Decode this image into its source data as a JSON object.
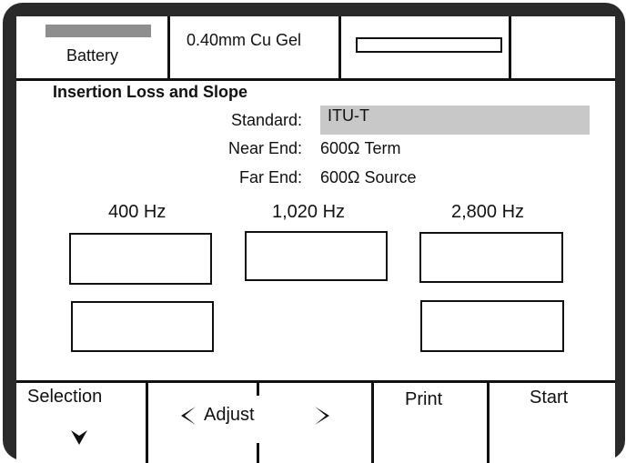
{
  "header": {
    "battery_label": "Battery",
    "cable_label": "0.40mm Cu Gel",
    "progress_fraction": 0
  },
  "main": {
    "title": "Insertion Loss and Slope",
    "standard_label": "Standard:",
    "standard_value": "ITU-T",
    "near_end_label": "Near End:",
    "near_end_value": "600Ω Term",
    "far_end_label": "Far End:",
    "far_end_value": "600Ω Source",
    "frequencies": [
      "400 Hz",
      "1,020 Hz",
      "2,800 Hz"
    ]
  },
  "softkeys": {
    "selection": "Selection",
    "adjust": "Adjust",
    "print": "Print",
    "start": "Start"
  },
  "icons": {
    "selection": "chevron-down-icon",
    "adjust_left": "chevron-left-icon",
    "adjust_right": "chevron-right-icon"
  }
}
